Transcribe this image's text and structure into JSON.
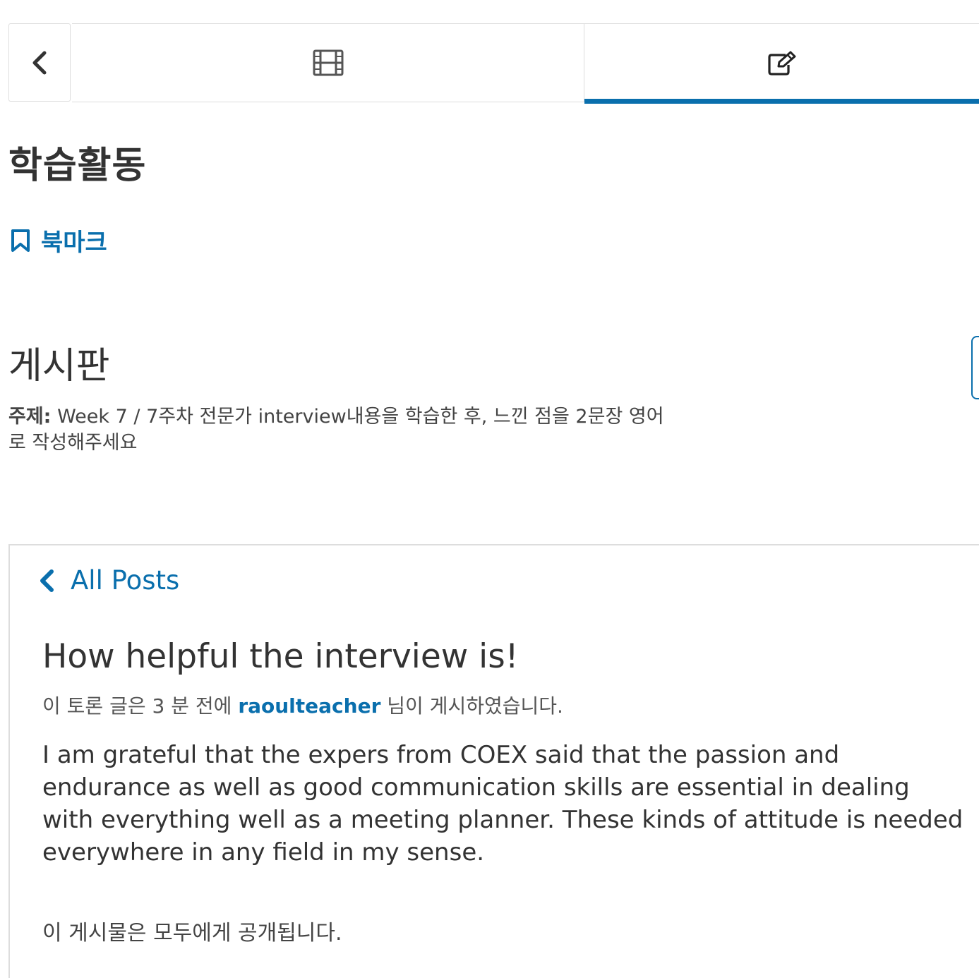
{
  "nav": {
    "back_icon": "chevron-left-icon",
    "tabs": [
      {
        "icon": "film-icon",
        "active": false
      },
      {
        "icon": "edit-icon",
        "active": true
      }
    ],
    "active_color": "#0a6fad"
  },
  "unit": {
    "title": "학습활동",
    "bookmark_icon": "bookmark-icon",
    "bookmark_label": "북마크"
  },
  "board": {
    "title": "게시판",
    "topic_label": "주제:",
    "topic_text": " Week 7 / 7주차 전문가 interview내용을 학습한 후, 느낀 점을 2문장 영어로 작성해주세요"
  },
  "thread": {
    "back_icon": "chevron-left-icon",
    "all_posts_label": "All Posts",
    "title": "How helpful the interview is!",
    "meta_prefix": "이 토론 글은 3 분 전에 ",
    "author": "raoulteacher",
    "meta_suffix": " 님이 게시하였습니다.",
    "body": "I am grateful that the expers from COEX said that the passion and endurance as well as good communication skills are essential in dealing with everything well as a meeting planner. These kinds of attitude is needed everywhere in any field in my sense.",
    "visibility": "이 게시물은 모두에게 공개됩니다."
  }
}
